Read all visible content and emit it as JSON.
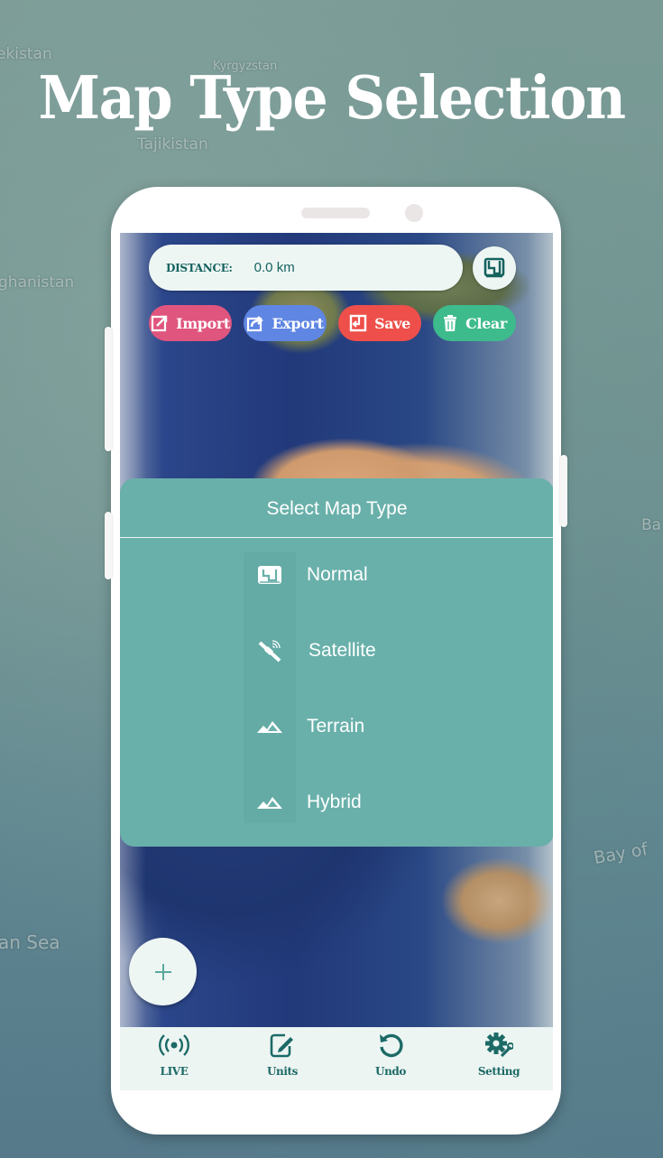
{
  "page_title": "Map Type Selection",
  "background_labels": [
    "ekistan",
    "Kyrgyzstan",
    "Tajikistan",
    "ghanistan",
    "Ba",
    "Bay of",
    "an Sea"
  ],
  "app": {
    "distance": {
      "label": "DISTANCE:",
      "value": "0.0  km"
    },
    "map_type_button_icon": "map-icon",
    "actions": [
      {
        "label": "Import",
        "icon": "import-icon",
        "color": "#e0557e"
      },
      {
        "label": "Export",
        "icon": "export-icon",
        "color": "#5f86e3"
      },
      {
        "label": "Save",
        "icon": "save-icon",
        "color": "#ee4f4a"
      },
      {
        "label": "Clear",
        "icon": "trash-icon",
        "color": "#3dbb8c"
      }
    ],
    "dialog": {
      "title": "Select Map Type",
      "options": [
        {
          "label": "Normal",
          "icon": "map-icon"
        },
        {
          "label": "Satellite",
          "icon": "satellite-icon"
        },
        {
          "label": "Terrain",
          "icon": "mountain-icon"
        },
        {
          "label": "Hybrid",
          "icon": "mountain-icon"
        }
      ],
      "color": "#69b0aa"
    },
    "fab": {
      "label": "+",
      "icon": "plus-icon"
    },
    "bottom_nav": [
      {
        "label": "LIVE",
        "icon": "broadcast-icon"
      },
      {
        "label": "Units",
        "icon": "edit-icon"
      },
      {
        "label": "Undo",
        "icon": "undo-icon"
      },
      {
        "label": "Setting",
        "icon": "settings-icon"
      }
    ],
    "accent_color": "#1c6a66"
  }
}
